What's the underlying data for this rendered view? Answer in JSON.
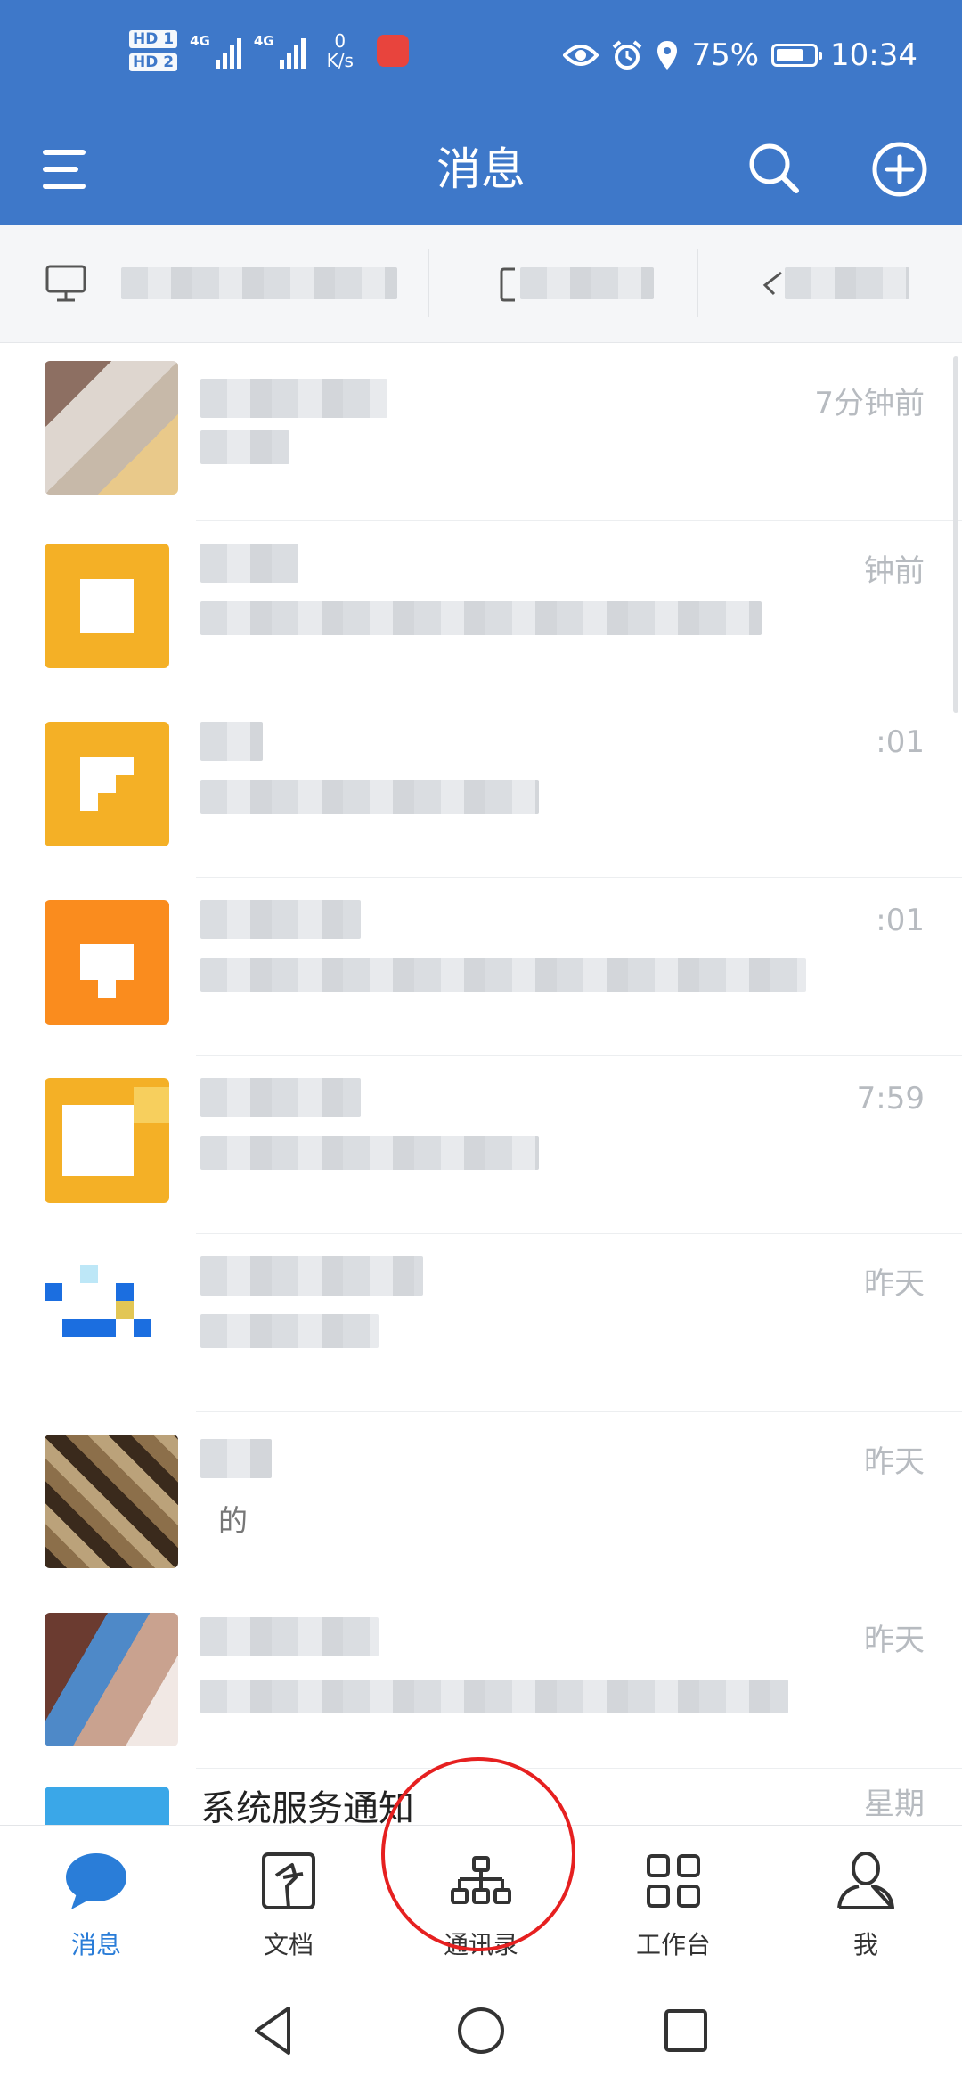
{
  "status_bar": {
    "hd1": "HD 1",
    "hd2": "HD 2",
    "network1": "4G",
    "network2": "4G",
    "speed_value": "0",
    "speed_unit": "K/s",
    "battery": "75%",
    "battery_level": 75,
    "time": "10:34",
    "icons": [
      "eye-icon",
      "alarm-icon",
      "location-icon",
      "battery-icon"
    ]
  },
  "header": {
    "title": "消息",
    "icons": [
      "menu-icon",
      "search-icon",
      "plus-circle-icon"
    ]
  },
  "quick_strip": {
    "icons": [
      "desktop-icon",
      "folder-icon",
      "tag-icon"
    ]
  },
  "conversations": [
    {
      "time": "7分钟前"
    },
    {
      "time": "钟前"
    },
    {
      "time": ":01"
    },
    {
      "time": ":01"
    },
    {
      "time": "7:59"
    },
    {
      "time": "昨天"
    },
    {
      "time": "昨天",
      "preview": "的"
    },
    {
      "time": "昨天"
    },
    {
      "time": "星期",
      "name": "系统服务通知"
    }
  ],
  "bottom_nav": {
    "items": [
      {
        "label": "消息",
        "icon": "chat-bubble-icon",
        "active": true
      },
      {
        "label": "文档",
        "icon": "document-icon"
      },
      {
        "label": "通讯录",
        "icon": "org-chart-icon"
      },
      {
        "label": "工作台",
        "icon": "grid-icon"
      },
      {
        "label": "我",
        "icon": "person-icon"
      }
    ]
  },
  "colors": {
    "header": "#3e78c9",
    "accent": "#2a7dd8",
    "annotation_circle": "#e62020"
  }
}
